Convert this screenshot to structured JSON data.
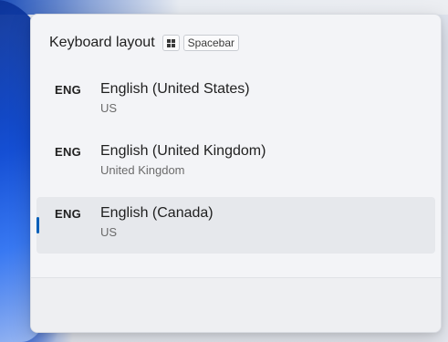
{
  "flyout": {
    "title": "Keyboard layout",
    "shortcut": {
      "win_key_icon": "windows-logo-icon",
      "key_label": "Spacebar"
    }
  },
  "layouts": [
    {
      "code": "ENG",
      "name": "English (United States)",
      "sub": "US",
      "selected": false
    },
    {
      "code": "ENG",
      "name": "English (United Kingdom)",
      "sub": "United Kingdom",
      "selected": false
    },
    {
      "code": "ENG",
      "name": "English (Canada)",
      "sub": "US",
      "selected": true
    }
  ],
  "colors": {
    "accent": "#005fb8",
    "selected_bg": "#e6e8ec",
    "flyout_bg": "#f3f4f7"
  }
}
